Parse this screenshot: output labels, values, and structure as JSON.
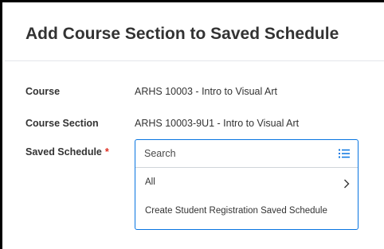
{
  "dialog": {
    "title": "Add Course Section to Saved Schedule"
  },
  "fields": {
    "course": {
      "label": "Course",
      "value": "ARHS 10003 - Intro to Visual Art"
    },
    "course_section": {
      "label": "Course Section",
      "value": "ARHS 10003-9U1 - Intro to Visual Art"
    },
    "saved_schedule": {
      "label": "Saved Schedule",
      "required_marker": "*"
    }
  },
  "prompt": {
    "search_placeholder": "Search",
    "search_value": "",
    "list_icon": "list-icon",
    "options": [
      {
        "label": "All",
        "icon": "chevron-right-icon"
      },
      {
        "label": "Create Student Registration Saved Schedule"
      }
    ]
  },
  "colors": {
    "accent": "#0875e1",
    "required": "#de2e21",
    "text": "#333333"
  }
}
